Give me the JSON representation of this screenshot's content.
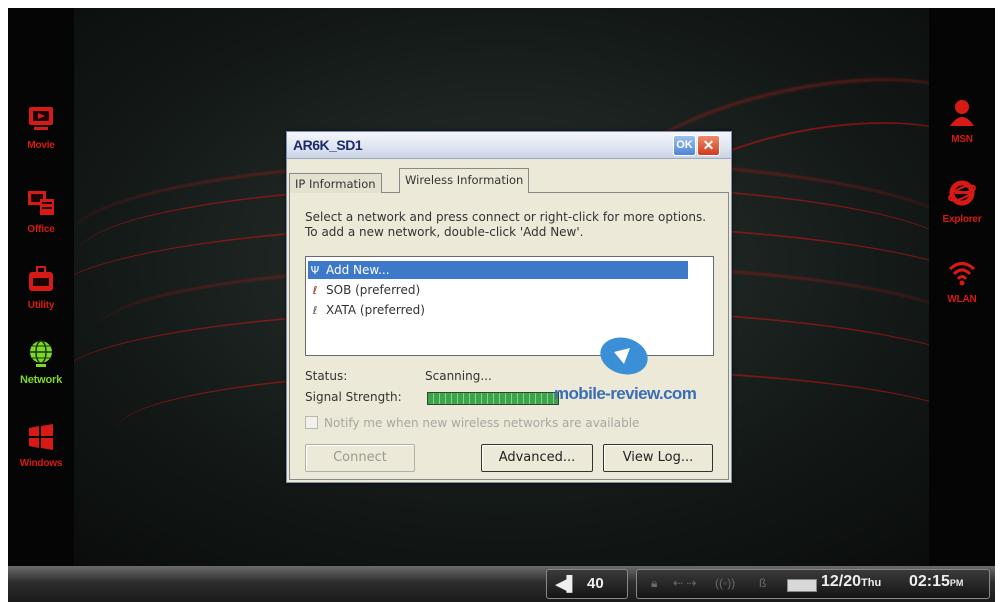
{
  "launcher_left": [
    {
      "label": "Movie",
      "icon": "movie-icon"
    },
    {
      "label": "Office",
      "icon": "office-icon"
    },
    {
      "label": "Utility",
      "icon": "utility-icon"
    },
    {
      "label": "Network",
      "icon": "network-globe-icon",
      "active": true
    },
    {
      "label": "Windows",
      "icon": "windows-icon"
    }
  ],
  "launcher_right": [
    {
      "label": "MSN",
      "icon": "msn-person-icon"
    },
    {
      "label": "Explorer",
      "icon": "explorer-icon"
    },
    {
      "label": "WLAN",
      "icon": "wlan-signal-icon"
    }
  ],
  "dialog": {
    "title": "AR6K_SD1",
    "ok_label": "OK",
    "close_label": "✕",
    "tabs": [
      {
        "label": "IP Information",
        "selected": false
      },
      {
        "label": "Wireless Information",
        "selected": true
      }
    ],
    "instructions": "Select a network and press connect or right-click for more options.  To add a new network, double-click 'Add New'.",
    "networks": [
      {
        "name": "Add New...",
        "icon": "antenna-icon",
        "selected": true
      },
      {
        "name": "SOB (preferred)",
        "icon": "network-icon",
        "selected": false
      },
      {
        "name": "XATA (preferred)",
        "icon": "network-icon",
        "selected": false
      }
    ],
    "status_label": "Status:",
    "status_value": "Scanning...",
    "signal_label": "Signal Strength:",
    "signal_level": 1.0,
    "notify_label": "Notify me when new wireless networks are available",
    "notify_checked": false,
    "connect_label": "Connect",
    "advanced_label": "Advanced...",
    "viewlog_label": "View Log..."
  },
  "watermark": "mobile-review.com",
  "taskbar": {
    "volume": "40",
    "date": "12/20",
    "day": "Thu",
    "time": "02:15",
    "ampm": "PM"
  },
  "colors": {
    "accent_red": "#d81a16",
    "active_green": "#7dd82a",
    "selection_blue": "#3d78c9"
  }
}
